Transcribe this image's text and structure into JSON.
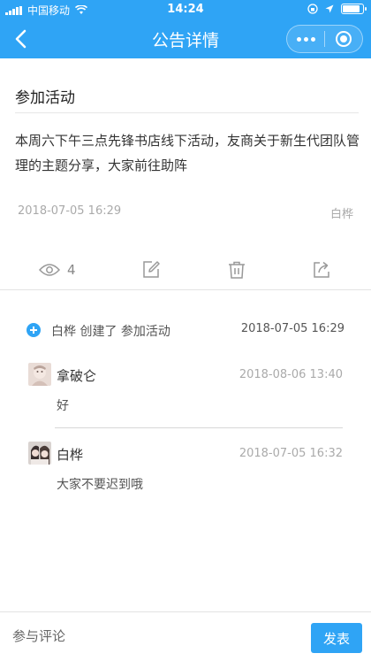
{
  "status_bar": {
    "carrier": "中国移动",
    "time": "14:24"
  },
  "nav": {
    "title": "公告详情",
    "back_icon": "chevron-left-icon",
    "more_icon": "more-dots-icon",
    "close_icon": "target-circle-icon"
  },
  "announcement": {
    "title": "参加活动",
    "body": "本周六下午三点先锋书店线下活动，友商关于新生代团队管理的主题分享，大家前往助阵",
    "date": "2018-07-05 16:29",
    "author": "白桦",
    "view_count": "4"
  },
  "activity": {
    "text": "白桦 创建了 参加活动",
    "time": "2018-07-05 16:29"
  },
  "comments": [
    {
      "name": "拿破仑",
      "time": "2018-08-06 13:40",
      "text": "好"
    },
    {
      "name": "白桦",
      "time": "2018-07-05 16:32",
      "text": "大家不要迟到哦"
    }
  ],
  "bottom": {
    "placeholder": "参与评论",
    "send_label": "发表"
  },
  "colors": {
    "primary": "#2fa4f5",
    "muted_text": "#aaaaaa"
  }
}
